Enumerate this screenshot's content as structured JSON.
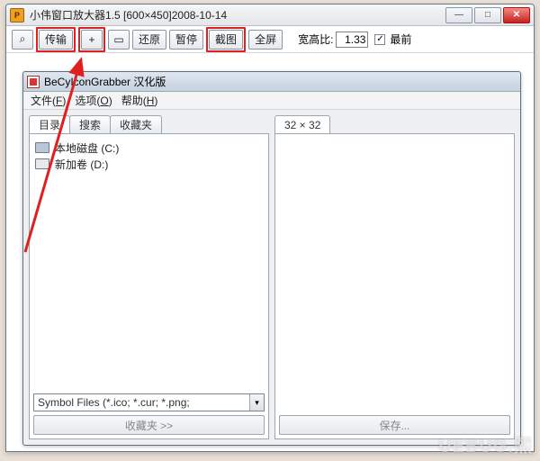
{
  "outer": {
    "title": "小伟窗口放大器1.5 [600×450]2008-10-14",
    "icon_label": "P",
    "window_buttons": {
      "min": "—",
      "max": "□",
      "close": "✕"
    }
  },
  "toolbar": {
    "zoom_icon": "⌕",
    "transfer": "传输",
    "plus": "+",
    "crop": "▭",
    "restore": "还原",
    "pause": "暂停",
    "screenshot": "截图",
    "fullscreen": "全屏",
    "ratio_label": "宽高比:",
    "ratio_value": "1.33",
    "topmost_checked": "✓",
    "topmost_label": "最前"
  },
  "inner": {
    "title": "BeCyIconGrabber 汉化版",
    "menus": [
      {
        "label": "文件",
        "accel": "F"
      },
      {
        "label": "选项",
        "accel": "O"
      },
      {
        "label": "帮助",
        "accel": "H"
      }
    ],
    "left_tabs": {
      "dir": "目录",
      "search": "搜索",
      "fav": "收藏夹"
    },
    "tree": [
      {
        "label": "本地磁盘 (C:)"
      },
      {
        "label": "新加卷 (D:)"
      }
    ],
    "filter": "Symbol Files (*.ico; *.cur; *.png; ",
    "dd_glyph": "▾",
    "fav_btn": "收藏夹 >>",
    "right_tab": "32 × 32",
    "save_btn": "保存..."
  },
  "watermark": "UEBUG.熙"
}
